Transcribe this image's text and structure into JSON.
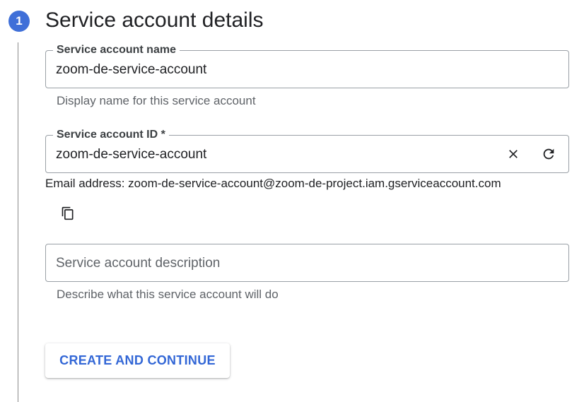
{
  "step": {
    "number": "1",
    "title": "Service account details"
  },
  "name_field": {
    "label": "Service account name",
    "value": "zoom-de-service-account",
    "hint": "Display name for this service account"
  },
  "id_field": {
    "label": "Service account ID *",
    "value": "zoom-de-service-account",
    "clear_icon": "close-icon",
    "refresh_icon": "refresh-icon"
  },
  "email": {
    "text": "Email address: zoom-de-service-account@zoom-de-project.iam.gserviceaccount.com",
    "copy_icon": "copy-icon"
  },
  "description_field": {
    "placeholder": "Service account description",
    "value": "",
    "hint": "Describe what this service account will do"
  },
  "actions": {
    "create_label": "CREATE AND CONTINUE"
  },
  "colors": {
    "step_badge": "#3f6fd8",
    "button_text": "#3367d6",
    "border": "#9aa0a6"
  }
}
